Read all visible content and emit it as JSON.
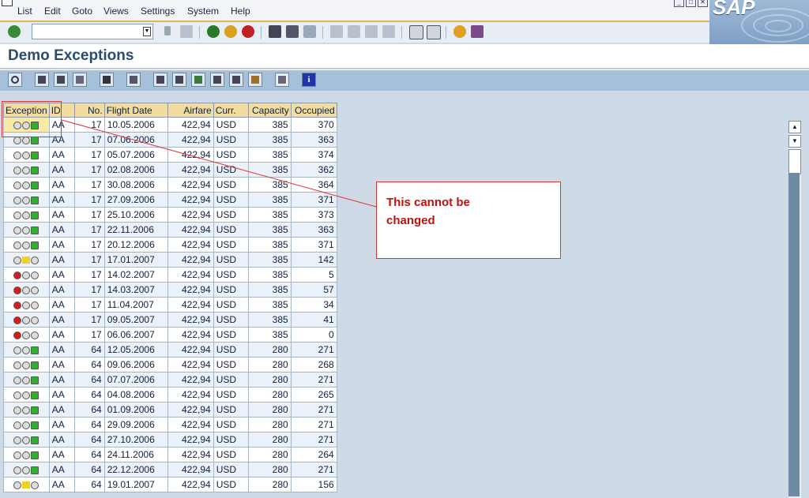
{
  "menu": {
    "items": [
      "List",
      "Edit",
      "Goto",
      "Views",
      "Settings",
      "System",
      "Help"
    ],
    "logo_text": "SAP"
  },
  "window_buttons": [
    "_",
    "□",
    "✕"
  ],
  "page_title": "Demo Exceptions",
  "callout_text": [
    "This cannot be",
    "changed"
  ],
  "grid": {
    "headers": [
      "Exception",
      "ID",
      "No.",
      "Flight Date",
      "Airfare",
      "Curr.",
      "Capacity",
      "Occupied"
    ],
    "rows": [
      {
        "exc": "green",
        "id": "AA",
        "no": "17",
        "date": "10.05.2006",
        "fare": "422,94",
        "curr": "USD",
        "cap": "385",
        "occ": "370"
      },
      {
        "exc": "green",
        "id": "AA",
        "no": "17",
        "date": "07.06.2006",
        "fare": "422,94",
        "curr": "USD",
        "cap": "385",
        "occ": "363"
      },
      {
        "exc": "green",
        "id": "AA",
        "no": "17",
        "date": "05.07.2006",
        "fare": "422,94",
        "curr": "USD",
        "cap": "385",
        "occ": "374"
      },
      {
        "exc": "green",
        "id": "AA",
        "no": "17",
        "date": "02.08.2006",
        "fare": "422,94",
        "curr": "USD",
        "cap": "385",
        "occ": "362"
      },
      {
        "exc": "green",
        "id": "AA",
        "no": "17",
        "date": "30.08.2006",
        "fare": "422,94",
        "curr": "USD",
        "cap": "385",
        "occ": "364"
      },
      {
        "exc": "green",
        "id": "AA",
        "no": "17",
        "date": "27.09.2006",
        "fare": "422,94",
        "curr": "USD",
        "cap": "385",
        "occ": "371"
      },
      {
        "exc": "green",
        "id": "AA",
        "no": "17",
        "date": "25.10.2006",
        "fare": "422,94",
        "curr": "USD",
        "cap": "385",
        "occ": "373"
      },
      {
        "exc": "green",
        "id": "AA",
        "no": "17",
        "date": "22.11.2006",
        "fare": "422,94",
        "curr": "USD",
        "cap": "385",
        "occ": "363"
      },
      {
        "exc": "green",
        "id": "AA",
        "no": "17",
        "date": "20.12.2006",
        "fare": "422,94",
        "curr": "USD",
        "cap": "385",
        "occ": "371"
      },
      {
        "exc": "yellow",
        "id": "AA",
        "no": "17",
        "date": "17.01.2007",
        "fare": "422,94",
        "curr": "USD",
        "cap": "385",
        "occ": "142"
      },
      {
        "exc": "red",
        "id": "AA",
        "no": "17",
        "date": "14.02.2007",
        "fare": "422,94",
        "curr": "USD",
        "cap": "385",
        "occ": "5"
      },
      {
        "exc": "red",
        "id": "AA",
        "no": "17",
        "date": "14.03.2007",
        "fare": "422,94",
        "curr": "USD",
        "cap": "385",
        "occ": "57"
      },
      {
        "exc": "red",
        "id": "AA",
        "no": "17",
        "date": "11.04.2007",
        "fare": "422,94",
        "curr": "USD",
        "cap": "385",
        "occ": "34"
      },
      {
        "exc": "red",
        "id": "AA",
        "no": "17",
        "date": "09.05.2007",
        "fare": "422,94",
        "curr": "USD",
        "cap": "385",
        "occ": "41"
      },
      {
        "exc": "red",
        "id": "AA",
        "no": "17",
        "date": "06.06.2007",
        "fare": "422,94",
        "curr": "USD",
        "cap": "385",
        "occ": "0"
      },
      {
        "exc": "green",
        "id": "AA",
        "no": "64",
        "date": "12.05.2006",
        "fare": "422,94",
        "curr": "USD",
        "cap": "280",
        "occ": "271"
      },
      {
        "exc": "green",
        "id": "AA",
        "no": "64",
        "date": "09.06.2006",
        "fare": "422,94",
        "curr": "USD",
        "cap": "280",
        "occ": "268"
      },
      {
        "exc": "green",
        "id": "AA",
        "no": "64",
        "date": "07.07.2006",
        "fare": "422,94",
        "curr": "USD",
        "cap": "280",
        "occ": "271"
      },
      {
        "exc": "green",
        "id": "AA",
        "no": "64",
        "date": "04.08.2006",
        "fare": "422,94",
        "curr": "USD",
        "cap": "280",
        "occ": "265"
      },
      {
        "exc": "green",
        "id": "AA",
        "no": "64",
        "date": "01.09.2006",
        "fare": "422,94",
        "curr": "USD",
        "cap": "280",
        "occ": "271"
      },
      {
        "exc": "green",
        "id": "AA",
        "no": "64",
        "date": "29.09.2006",
        "fare": "422,94",
        "curr": "USD",
        "cap": "280",
        "occ": "271"
      },
      {
        "exc": "green",
        "id": "AA",
        "no": "64",
        "date": "27.10.2006",
        "fare": "422,94",
        "curr": "USD",
        "cap": "280",
        "occ": "271"
      },
      {
        "exc": "green",
        "id": "AA",
        "no": "64",
        "date": "24.11.2006",
        "fare": "422,94",
        "curr": "USD",
        "cap": "280",
        "occ": "264"
      },
      {
        "exc": "green",
        "id": "AA",
        "no": "64",
        "date": "22.12.2006",
        "fare": "422,94",
        "curr": "USD",
        "cap": "280",
        "occ": "271"
      },
      {
        "exc": "yellow",
        "id": "AA",
        "no": "64",
        "date": "19.01.2007",
        "fare": "422,94",
        "curr": "USD",
        "cap": "280",
        "occ": "156"
      }
    ]
  },
  "colors": {
    "header_bg": "#f3dca0",
    "title": "#2b4c6f",
    "callout_red": "#c01010",
    "light_green": "#2fb12f",
    "light_yellow": "#f0d020",
    "light_red": "#d61c1c"
  },
  "icons": {
    "toolbar1": [
      "check-icon",
      "back-arrow-icon",
      "save-icon",
      "back-icon",
      "exit-icon",
      "cancel-icon",
      "print-icon",
      "find-icon",
      "find-next-icon",
      "first-page-icon",
      "prev-page-icon",
      "next-page-icon",
      "last-page-icon",
      "new-session-icon",
      "shortcut-icon",
      "help-icon",
      "layout-icon"
    ],
    "toolbar2": [
      "details-icon",
      "sort-ascending-icon",
      "sort-descending-icon",
      "filter-icon",
      "sum-icon",
      "subtotal-icon",
      "print-preview-icon",
      "export-icon",
      "mail-icon",
      "word-icon",
      "excel-icon",
      "graphic-icon",
      "layout-grid-icon",
      "info-icon"
    ]
  }
}
